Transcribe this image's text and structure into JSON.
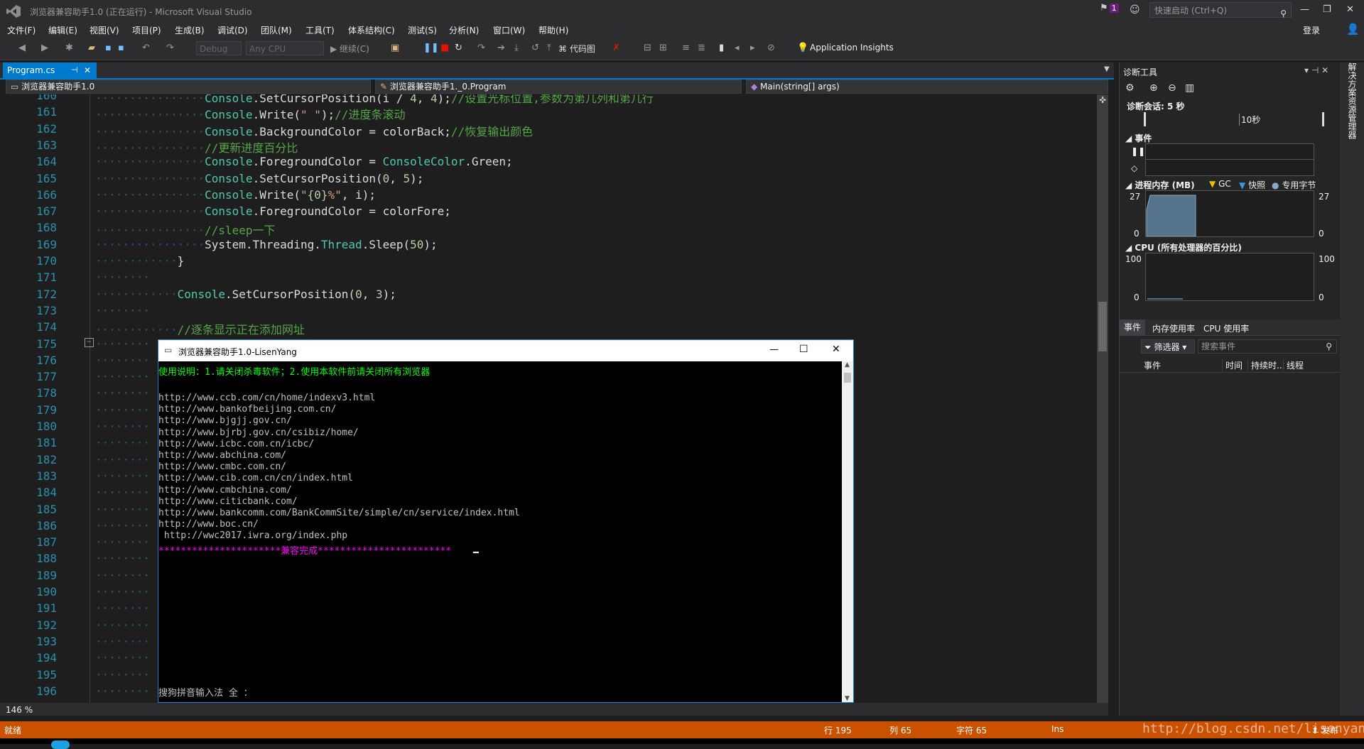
{
  "window": {
    "title": "浏览器兼容助手1.0 (正在运行) - Microsoft Visual Studio",
    "notification_count": "1",
    "quick_launch_placeholder": "快速启动 (Ctrl+Q)",
    "sign_in": "登录"
  },
  "menu": [
    "文件(F)",
    "编辑(E)",
    "视图(V)",
    "项目(P)",
    "生成(B)",
    "调试(D)",
    "团队(M)",
    "工具(T)",
    "体系结构(C)",
    "测试(S)",
    "分析(N)",
    "窗口(W)",
    "帮助(H)"
  ],
  "toolbar": {
    "config": "Debug",
    "platform": "Any CPU",
    "continue_label": "继续(C)",
    "codemap_label": "代码图",
    "app_insights": "Application Insights"
  },
  "tab": {
    "label": "Program.cs"
  },
  "nav": {
    "project": "浏览器兼容助手1.0",
    "class": "浏览器兼容助手1._0.Program",
    "member": "Main(string[] args)"
  },
  "editor": {
    "lines": [
      {
        "n": "160",
        "code": "Console.SetCursorPosition(i / 4, 4);//设置光标位置,参数为第几列和第几行"
      },
      {
        "n": "161",
        "code": "Console.Write(\" \");//进度条滚动"
      },
      {
        "n": "162",
        "code": "Console.BackgroundColor = colorBack;//恢复输出颜色"
      },
      {
        "n": "163",
        "code": "//更新进度百分比"
      },
      {
        "n": "164",
        "code": "Console.ForegroundColor = ConsoleColor.Green;"
      },
      {
        "n": "165",
        "code": "Console.SetCursorPosition(0, 5);"
      },
      {
        "n": "166",
        "code": "Console.Write(\"{0}%\", i);"
      },
      {
        "n": "167",
        "code": "Console.ForegroundColor = colorFore;"
      },
      {
        "n": "168",
        "code": "//sleep一下"
      },
      {
        "n": "169",
        "code": "System.Threading.Thread.Sleep(50);"
      },
      {
        "n": "170",
        "code": "}"
      },
      {
        "n": "171",
        "code": ""
      },
      {
        "n": "172",
        "code": "Console.SetCursorPosition(0, 3);"
      },
      {
        "n": "173",
        "code": ""
      },
      {
        "n": "174",
        "code": "//逐条显示正在添加网址"
      },
      {
        "n": "175",
        "code": ""
      },
      {
        "n": "176",
        "code": ""
      },
      {
        "n": "177",
        "code": ""
      },
      {
        "n": "178",
        "code": ""
      },
      {
        "n": "179",
        "code": ""
      },
      {
        "n": "180",
        "code": ""
      },
      {
        "n": "181",
        "code": ""
      },
      {
        "n": "182",
        "code": ""
      },
      {
        "n": "183",
        "code": ""
      },
      {
        "n": "184",
        "code": ""
      },
      {
        "n": "185",
        "code": ""
      },
      {
        "n": "186",
        "code": ""
      },
      {
        "n": "187",
        "code": ""
      },
      {
        "n": "188",
        "code": ""
      },
      {
        "n": "189",
        "code": ""
      },
      {
        "n": "190",
        "code": ""
      },
      {
        "n": "191",
        "code": ""
      },
      {
        "n": "192",
        "code": ""
      },
      {
        "n": "193",
        "code": ""
      },
      {
        "n": "194",
        "code": ""
      },
      {
        "n": "195",
        "code": ""
      },
      {
        "n": "196",
        "code": ""
      }
    ],
    "zoom": "146 %"
  },
  "diag": {
    "title": "诊断工具",
    "session": "诊断会话: 5 秒",
    "timeline_tick": "10秒",
    "events_header": "事件",
    "memory_header": "进程内存 (MB)",
    "legend_gc": "GC",
    "legend_snapshot": "快照",
    "legend_private": "专用字节",
    "mem_max": "27",
    "mem_min": "0",
    "cpu_header": "CPU (所有处理器的百分比)",
    "cpu_max": "100",
    "cpu_min": "0",
    "tabs": [
      "事件",
      "内存使用率",
      "CPU 使用率"
    ],
    "filter_label": "筛选器",
    "search_placeholder": "搜索事件",
    "columns": [
      "事件",
      "时间",
      "持续时...",
      "线程"
    ],
    "side_label": "解决方案资源管理器"
  },
  "console": {
    "title": "浏览器兼容助手1.0-LisenYang",
    "usage": "使用说明：1.请关闭杀毒软件；2.使用本软件前请关闭所有浏览器",
    "urls": [
      "http://www.ccb.com/cn/home/indexv3.html",
      "http://www.bankofbeijing.com.cn/",
      "http://www.bjgjj.gov.cn/",
      "http://www.bjrbj.gov.cn/csibiz/home/",
      "http://www.icbc.com.cn/icbc/",
      "http://www.abchina.com/",
      "http://www.cmbc.com.cn/",
      "http://www.cib.com.cn/cn/index.html",
      "http://www.cmbchina.com/",
      "http://www.citicbank.com/",
      "http://www.bankcomm.com/BankCommSite/simple/cn/service/index.html",
      "http://www.boc.cn/",
      " http://wwc2017.iwra.org/index.php"
    ],
    "done": "**********************兼容完成************************",
    "ime": "搜狗拼音输入法 全 ："
  },
  "status": {
    "ready": "就绪",
    "row": "行 195",
    "col": "列 65",
    "chars": "字符 65",
    "ins": "Ins",
    "watermark": "http://blog.csdn.net/lisenyang",
    "publish": "发布"
  },
  "colors": {
    "accent": "#007acc",
    "status": "#ca5100",
    "console_green": "#00ff00",
    "console_magenta": "#ff00ff"
  }
}
